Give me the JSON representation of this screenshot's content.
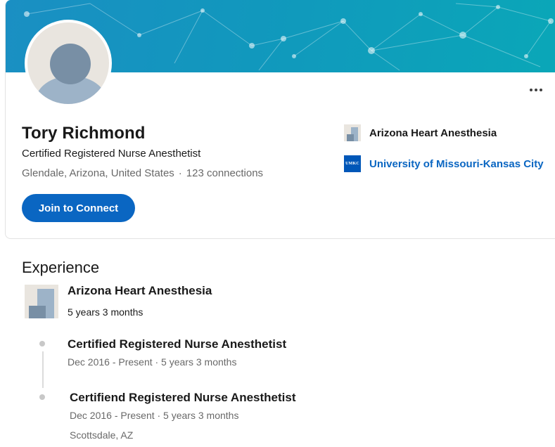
{
  "profile": {
    "name": "Tory Richmond",
    "headline": "Certified Registered Nurse Anesthetist",
    "location": "Glendale, Arizona, United States",
    "connections": "123 connections",
    "join_button": "Join to Connect"
  },
  "sidebar": {
    "company": "Arizona Heart Anesthesia",
    "school": "University of Missouri-Kansas City",
    "school_logo_text": "UMKC"
  },
  "experience": {
    "title": "Experience",
    "company": "Arizona Heart Anesthesia",
    "duration": "5 years 3 months",
    "roles": [
      {
        "title": "Certified Registered Nurse Anesthetist",
        "dates": "Dec 2016 - Present · 5 years 3 months"
      },
      {
        "title": "Certifiend Registered Nurse Anesthetist",
        "dates": "Dec 2016 - Present · 5 years 3 months",
        "location": "Scottsdale, AZ"
      }
    ]
  },
  "colors": {
    "accent": "#0a66c2",
    "banner_start": "#1a8fc3",
    "banner_end": "#0aa7b8"
  },
  "icons": {
    "more": "more-horizontal-icon",
    "avatar": "default-avatar-icon",
    "company_logo": "company-logo-placeholder-icon",
    "school_logo": "umkc-logo-icon"
  }
}
